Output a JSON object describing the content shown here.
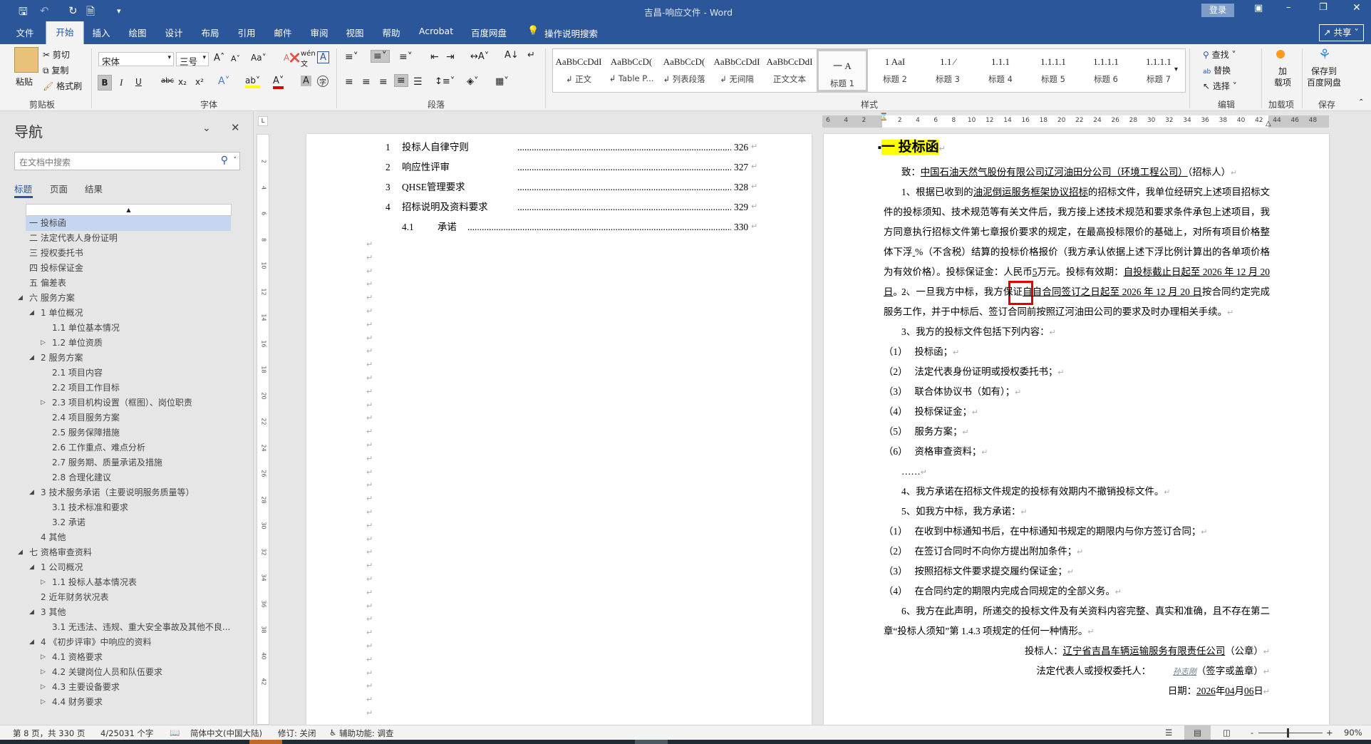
{
  "window": {
    "title": "吉昌-响应文件  -  Word",
    "login_label": "登录",
    "share_label": "共享"
  },
  "quick_access": [
    "save-icon",
    "undo-icon",
    "redo-icon",
    "new-document-icon",
    "customize-icon"
  ],
  "tabs": [
    {
      "label": "文件"
    },
    {
      "label": "开始",
      "active": true
    },
    {
      "label": "插入"
    },
    {
      "label": "绘图"
    },
    {
      "label": "设计"
    },
    {
      "label": "布局"
    },
    {
      "label": "引用"
    },
    {
      "label": "邮件"
    },
    {
      "label": "审阅"
    },
    {
      "label": "视图"
    },
    {
      "label": "帮助"
    },
    {
      "label": "Acrobat"
    },
    {
      "label": "百度网盘"
    }
  ],
  "tell_me": "操作说明搜索",
  "ribbon": {
    "clipboard": {
      "paste": "粘贴",
      "cut": "剪切",
      "copy": "复制",
      "format_painter": "格式刷",
      "label": "剪贴板"
    },
    "font": {
      "name": "宋体",
      "size": "三号",
      "label": "字体",
      "bold": "B",
      "italic": "I",
      "underline": "U",
      "strike": "abc",
      "sub": "x₂",
      "sup": "x²",
      "font_color": "#e00000",
      "highlight_color": "#ffff00"
    },
    "paragraph": {
      "label": "段落"
    },
    "styles": {
      "label": "样式",
      "items": [
        {
          "preview": "AaBbCcDdI",
          "name": "↲ 正文"
        },
        {
          "preview": "AaBbCcD(",
          "name": "↲ Table P..."
        },
        {
          "preview": "AaBbCcD(",
          "name": "↲ 列表段落"
        },
        {
          "preview": "AaBbCcDdI",
          "name": "↲ 无间隔"
        },
        {
          "preview": "AaBbCcDdI",
          "name": "正文文本"
        },
        {
          "preview": "一  A",
          "name": "标题 1",
          "selected": true
        },
        {
          "preview": "1  AaI",
          "name": "标题 2"
        },
        {
          "preview": "1.1  ∕",
          "name": "标题 3"
        },
        {
          "preview": "1.1.1",
          "name": "标题 4"
        },
        {
          "preview": "1.1.1.1",
          "name": "标题 5"
        },
        {
          "preview": "1.1.1.1",
          "name": "标题 6"
        },
        {
          "preview": "1.1.1.1",
          "name": "标题 7"
        }
      ]
    },
    "editing": {
      "find": "查找",
      "replace": "替换",
      "select": "选择",
      "label": "编辑"
    },
    "addins": {
      "button": "加\n载项",
      "label": "加载项"
    },
    "save": {
      "button": "保存到\n百度网盘",
      "label": "保存"
    }
  },
  "nav": {
    "title": "导航",
    "search_placeholder": "在文档中搜索",
    "tabs": [
      "标题",
      "页面",
      "结果"
    ],
    "active_tab": "标题",
    "items": [
      {
        "text": "一 投标函",
        "level": 0,
        "selected": true
      },
      {
        "text": "二 法定代表人身份证明",
        "level": 0
      },
      {
        "text": "三 授权委托书",
        "level": 0
      },
      {
        "text": "四 投标保证金",
        "level": 0
      },
      {
        "text": "五 偏差表",
        "level": 0
      },
      {
        "text": "六 服务方案",
        "level": 0,
        "state": "expanded"
      },
      {
        "text": "1 单位概况",
        "level": 1,
        "state": "expanded"
      },
      {
        "text": "1.1 单位基本情况",
        "level": 2
      },
      {
        "text": "1.2 单位资质",
        "level": 2,
        "state": "collapsed"
      },
      {
        "text": "2 服务方案",
        "level": 1,
        "state": "expanded"
      },
      {
        "text": "2.1 项目内容",
        "level": 2
      },
      {
        "text": "2.2 项目工作目标",
        "level": 2
      },
      {
        "text": "2.3 项目机构设置（框图）、岗位职责",
        "level": 2,
        "state": "collapsed"
      },
      {
        "text": "2.4 项目服务方案",
        "level": 2
      },
      {
        "text": "2.5 服务保障措施",
        "level": 2
      },
      {
        "text": "2.6 工作重点、难点分析",
        "level": 2
      },
      {
        "text": "2.7 服务期、质量承诺及措施",
        "level": 2
      },
      {
        "text": "2.8 合理化建议",
        "level": 2
      },
      {
        "text": "3 技术服务承诺（主要说明服务质量等）",
        "level": 1,
        "state": "expanded"
      },
      {
        "text": "3.1 技术标准和要求",
        "level": 2
      },
      {
        "text": "3.2 承诺",
        "level": 2
      },
      {
        "text": "4 其他",
        "level": 1
      },
      {
        "text": "七 资格审查资料",
        "level": 0,
        "state": "expanded"
      },
      {
        "text": "1 公司概况",
        "level": 1,
        "state": "expanded"
      },
      {
        "text": "1.1 投标人基本情况表",
        "level": 2,
        "state": "collapsed"
      },
      {
        "text": "2 近年财务状况表",
        "level": 1
      },
      {
        "text": "3 其他",
        "level": 1,
        "state": "expanded"
      },
      {
        "text": "3.1 无违法、违规、重大安全事故及其他不良...",
        "level": 2
      },
      {
        "text": "4 《初步评审》中响应的资料",
        "level": 1,
        "state": "expanded"
      },
      {
        "text": "4.1 资格要求",
        "level": 2,
        "state": "collapsed"
      },
      {
        "text": "4.2 关键岗位人员和队伍要求",
        "level": 2,
        "state": "collapsed"
      },
      {
        "text": "4.3 主要设备要求",
        "level": 2,
        "state": "collapsed"
      },
      {
        "text": "4.4 财务要求",
        "level": 2,
        "state": "collapsed"
      }
    ]
  },
  "ruler": {
    "horizontal_labels": [
      "6",
      "4",
      "2",
      "",
      "2",
      "4",
      "6",
      "8",
      "10",
      "12",
      "14",
      "16",
      "18",
      "20",
      "22",
      "24",
      "26",
      "28",
      "30",
      "32",
      "34",
      "36",
      "38",
      "40",
      "42",
      "44",
      "46",
      "48"
    ],
    "vertical_labels": [
      "2",
      "4",
      "6",
      "8",
      "10",
      "12",
      "14",
      "16",
      "18",
      "20",
      "22",
      "24",
      "26",
      "28",
      "30",
      "32",
      "34",
      "36",
      "38",
      "40",
      "42"
    ]
  },
  "left_page": {
    "toc": [
      {
        "num": "1",
        "title": "投标人自律守则",
        "page": "326"
      },
      {
        "num": "2",
        "title": "响应性评审",
        "page": "327"
      },
      {
        "num": "3",
        "title": "QHSE管理要求",
        "page": "328"
      },
      {
        "num": "4",
        "title": "招标说明及资料要求",
        "page": "329"
      },
      {
        "num": "4.1",
        "title": "承诺",
        "page": "330",
        "sub": true
      }
    ]
  },
  "right_page": {
    "heading": "一 投标函",
    "heading_highlight": "#ffff00",
    "paragraphs": [
      {
        "style": "ind",
        "segments": [
          {
            "t": "致："
          },
          {
            "t": "中国石油天然气股份有限公司辽河油田分公司（环境工程公司）",
            "u": true
          },
          {
            "t": "（招标人）"
          }
        ]
      },
      {
        "style": "ind",
        "segments": [
          {
            "t": "1、根据已收到的"
          },
          {
            "t": "油泥倒运服务框架协议招标",
            "u": true
          },
          {
            "t": "的招标文件，我单位经研究上述项目招标文件的投标须知、技术规范等有关文件后，我方接上述技术规范和要求条件承包上述项目，我方同意执行招标文件第七章报价要求的规定，在最高投标限价的基础上，对所有项目价格整体下浮"
          },
          {
            "t": "   ",
            "u": true
          },
          {
            "t": "%（不含税）结算的投标价格报价（我方承认依据上述下浮比例计算出的各单项价格为有效价格）。投标保证金：人民币"
          },
          {
            "t": "5",
            "u": true
          },
          {
            "t": "万元。投标有效期："
          },
          {
            "t": "自投标截止日起至 2026 年 12 月 20 日",
            "u": true
          },
          {
            "t": "。"
          }
        ]
      },
      {
        "style": "ind",
        "segments": [
          {
            "t": "2、一旦我方中标，我方保证"
          },
          {
            "t": "自自合同签订之日起至 2026 年 12 月 20 日",
            "u": true
          },
          {
            "t": "按合同约定完成服务工作，并于中标后、签订合同前按照辽河油田公司的要求及时办理相关手续。"
          }
        ]
      },
      {
        "style": "ind",
        "segments": [
          {
            "t": "3、我方的投标文件包括下列内容："
          }
        ]
      },
      {
        "style": "item",
        "segments": [
          {
            "t": "（1）　 投标函；"
          }
        ]
      },
      {
        "style": "item",
        "segments": [
          {
            "t": "（2）　 法定代表身份证明或授权委托书；"
          }
        ]
      },
      {
        "style": "item",
        "segments": [
          {
            "t": "（3）　 联合体协议书（如有）；"
          }
        ]
      },
      {
        "style": "item",
        "segments": [
          {
            "t": "（4）　 投标保证金；"
          }
        ]
      },
      {
        "style": "item",
        "segments": [
          {
            "t": "（5）　 服务方案；"
          }
        ]
      },
      {
        "style": "item",
        "segments": [
          {
            "t": "（6）　 资格审查资料；"
          }
        ]
      },
      {
        "style": "ind",
        "segments": [
          {
            "t": "……"
          }
        ]
      },
      {
        "style": "ind",
        "segments": [
          {
            "t": "4、我方承诺在招标文件规定的投标有效期内不撤销投标文件。"
          }
        ]
      },
      {
        "style": "ind",
        "segments": [
          {
            "t": "5、如我方中标，我方承诺："
          }
        ]
      },
      {
        "style": "item",
        "segments": [
          {
            "t": "（1）　 在收到中标通知书后，在中标通知书规定的期限内与你方签订合同；"
          }
        ]
      },
      {
        "style": "item",
        "segments": [
          {
            "t": "（2）　 在签订合同时不向你方提出附加条件；"
          }
        ]
      },
      {
        "style": "item",
        "segments": [
          {
            "t": "（3）　 按照招标文件要求提交履约保证金；"
          }
        ]
      },
      {
        "style": "item",
        "segments": [
          {
            "t": "（4）　 在合同约定的期限内完成合同规定的全部义务。"
          }
        ]
      },
      {
        "style": "ind",
        "segments": [
          {
            "t": "6、我方在此声明，所递交的投标文件及有关资料内容完整、真实和准确，且不存在第二章“投标人须知”第 1.4.3 项规定的任何一种情形。"
          }
        ]
      },
      {
        "style": "right",
        "segments": [
          {
            "t": "投标人："
          },
          {
            "t": "辽宁省吉昌车辆运输服务有限责任公司",
            "u": true
          },
          {
            "t": "（公章）"
          }
        ]
      },
      {
        "style": "right",
        "segments": [
          {
            "t": "法定代表人或授权委托人："
          },
          {
            "t": "孙志刚",
            "u": true,
            "signature": true
          },
          {
            "t": "（签字或盖章）"
          }
        ]
      },
      {
        "style": "right",
        "segments": [
          {
            "t": "日期："
          },
          {
            "t": "2026",
            "u": true
          },
          {
            "t": "年"
          },
          {
            "t": "04",
            "u": true
          },
          {
            "t": "月"
          },
          {
            "t": "06",
            "u": true
          },
          {
            "t": "日"
          }
        ]
      }
    ],
    "annotation_color": "#e00000"
  },
  "status": {
    "page": "第 8 页，共 330 页",
    "words": "4/25031 个字",
    "language": "简体中文(中国大陆)",
    "track_changes": "修订: 关闭",
    "accessibility": "辅助功能: 调查",
    "zoom": "90%",
    "zoom_level_percent": 90
  }
}
